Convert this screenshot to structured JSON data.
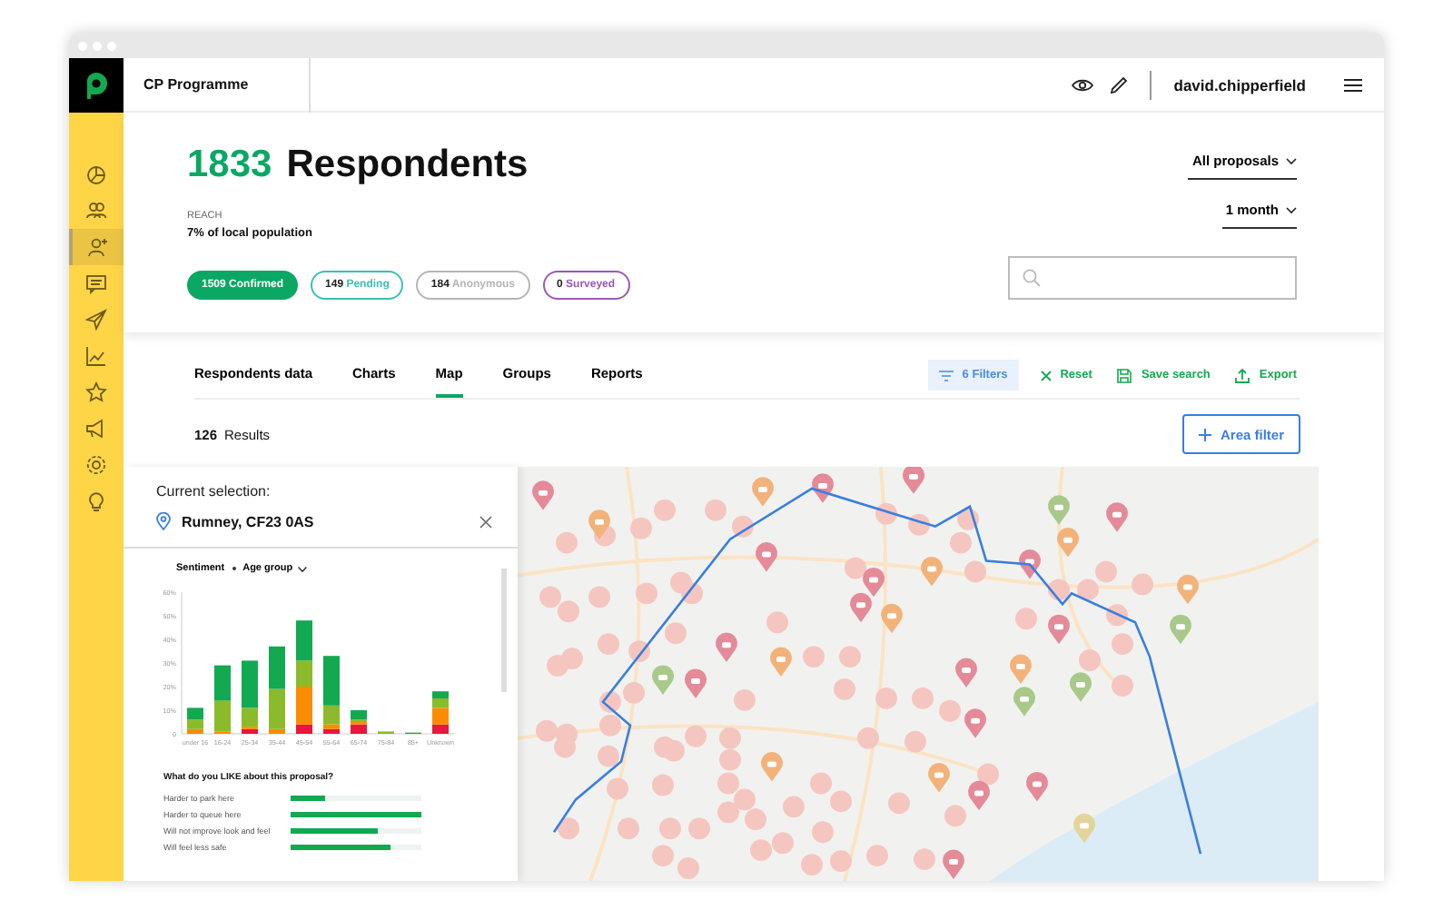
{
  "app": {
    "title": "CP Programme",
    "user": "david.chipperfield"
  },
  "sidebar": {
    "items": [
      {
        "selected": false
      },
      {
        "selected": false
      },
      {
        "selected": true
      },
      {
        "selected": false
      },
      {
        "selected": false
      },
      {
        "selected": false
      },
      {
        "selected": false
      },
      {
        "selected": false
      },
      {
        "selected": false
      },
      {
        "selected": false
      }
    ]
  },
  "summary": {
    "count": "1833",
    "title": "Respondents",
    "reach_label": "REACH",
    "reach_value": "7% of local population",
    "chips": [
      {
        "count": "1509",
        "label": "Confirmed",
        "kind": "filled",
        "color": "#0aa864"
      },
      {
        "count": "149",
        "label": "Pending",
        "kind": "outline",
        "color": "#3bbfb1"
      },
      {
        "count": "184",
        "label": "Anonymous",
        "kind": "outline",
        "color": "#b5b5b5"
      },
      {
        "count": "0",
        "label": "Surveyed",
        "kind": "outline",
        "color": "#9b59b6"
      }
    ],
    "dropdowns": [
      "All proposals",
      "1 month"
    ]
  },
  "tabs": [
    {
      "label": "Respondents data",
      "selected": false
    },
    {
      "label": "Charts",
      "selected": false
    },
    {
      "label": "Map",
      "selected": true
    },
    {
      "label": "Groups",
      "selected": false
    },
    {
      "label": "Reports",
      "selected": false
    }
  ],
  "actions": {
    "filters": "6 Filters",
    "reset": "Reset",
    "save": "Save search",
    "export": "Export"
  },
  "results": {
    "count": "126",
    "label": "Results",
    "area_filter": "Area filter"
  },
  "selection": {
    "heading": "Current selection:",
    "place": "Rumney, CF23 0AS",
    "chart_controls": [
      "Sentiment",
      "Age group"
    ],
    "chart_data": {
      "type": "bar",
      "stacked": true,
      "categories": [
        "under 16",
        "16-24",
        "25-34",
        "35-44",
        "45-54",
        "55-64",
        "65-74",
        "75-84",
        "85+",
        "Unknown"
      ],
      "ylim": [
        0,
        60
      ],
      "yticks": [
        {
          "value": 0,
          "label": "0"
        },
        {
          "value": 10,
          "label": "10%"
        },
        {
          "value": 20,
          "label": "20%"
        },
        {
          "value": 30,
          "label": "30%"
        },
        {
          "value": 40,
          "label": "40%"
        },
        {
          "value": 50,
          "label": "50%"
        },
        {
          "value": 60,
          "label": "60%"
        }
      ],
      "series": [
        {
          "color": "#e8173c",
          "values": [
            0,
            0,
            2,
            0,
            4,
            2,
            4,
            0,
            0,
            4
          ]
        },
        {
          "color": "#fb8c00",
          "values": [
            2,
            1,
            1,
            2,
            16,
            2,
            1,
            0,
            0,
            7
          ]
        },
        {
          "color": "#8bbb2a",
          "values": [
            4,
            13,
            8,
            17,
            11,
            8,
            1,
            1,
            0,
            4
          ]
        },
        {
          "color": "#12a951",
          "values": [
            5,
            15,
            20,
            18,
            17,
            21,
            4,
            0,
            0.5,
            3
          ]
        }
      ]
    },
    "question": "What do you LIKE about this proposal?",
    "answers": [
      {
        "label": "Harder to park here",
        "level": 0.27
      },
      {
        "label": "Harder to queue here",
        "level": 1.0
      },
      {
        "label": "Will not improve look and feel",
        "level": 0.66
      },
      {
        "label": "Will feel less safe",
        "level": 0.77
      }
    ]
  }
}
